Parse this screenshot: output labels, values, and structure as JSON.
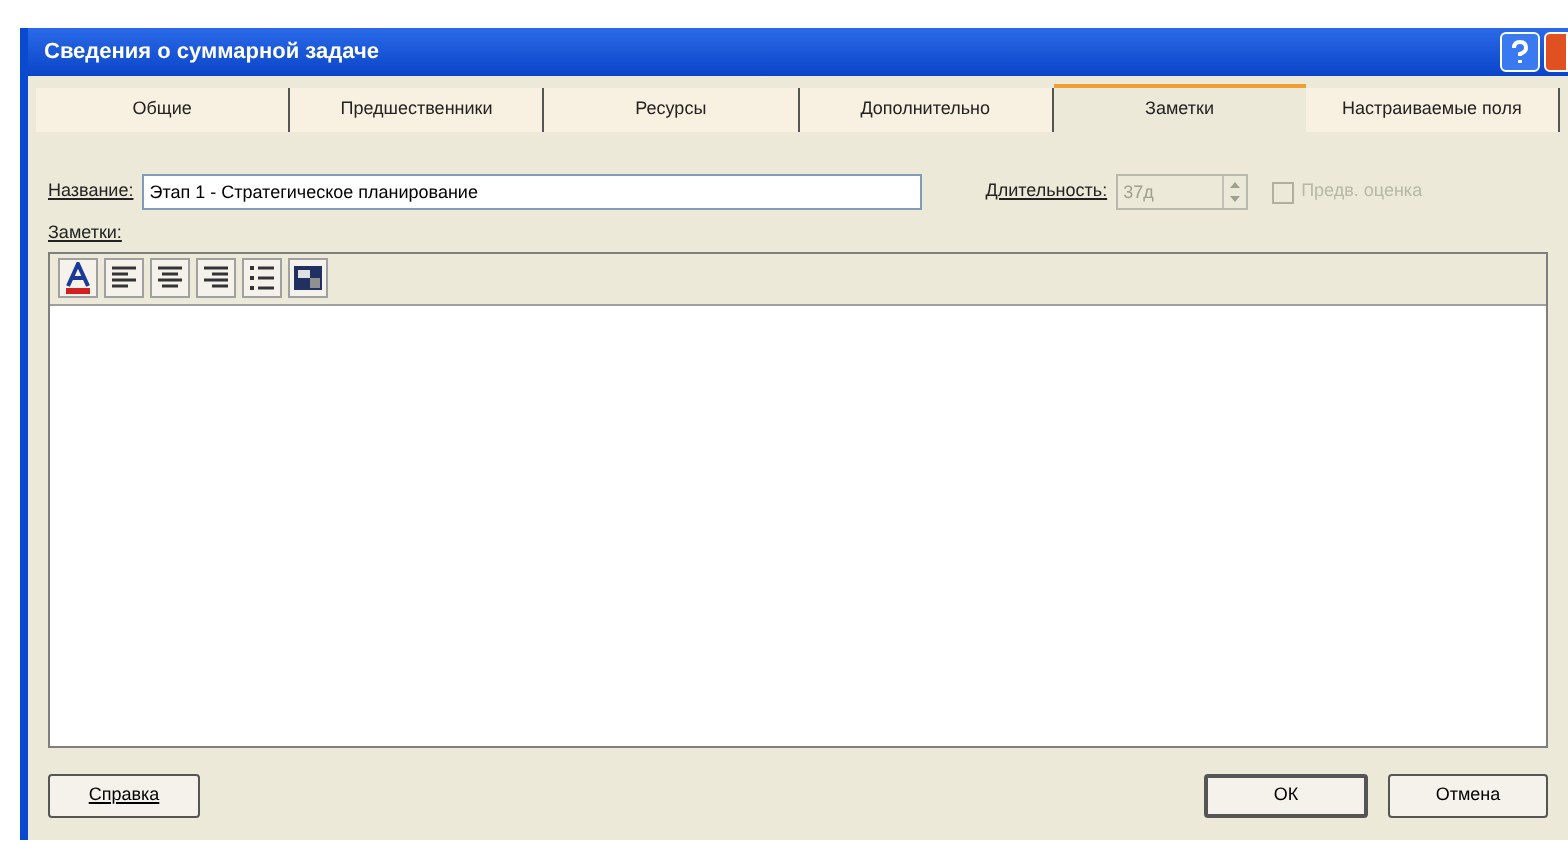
{
  "window": {
    "title": "Сведения о суммарной задаче"
  },
  "tabs": [
    {
      "label": "Общие",
      "selected": false
    },
    {
      "label": "Предшественники",
      "selected": false
    },
    {
      "label": "Ресурсы",
      "selected": false
    },
    {
      "label": "Дополнительно",
      "selected": false
    },
    {
      "label": "Заметки",
      "selected": true
    },
    {
      "label": "Настраиваемые поля",
      "selected": false
    }
  ],
  "name_field": {
    "label": "Название:",
    "value": "Этап 1 - Стратегическое планирование"
  },
  "duration_field": {
    "label": "Длительность:",
    "value": "37д",
    "disabled": true
  },
  "estimate_checkbox": {
    "label": "Предв. оценка",
    "checked": false,
    "disabled": true
  },
  "notes": {
    "label": "Заметки:",
    "toolbar": [
      {
        "kind": "font"
      },
      {
        "kind": "align-left"
      },
      {
        "kind": "align-center"
      },
      {
        "kind": "align-right"
      },
      {
        "kind": "bullets"
      },
      {
        "kind": "object"
      }
    ]
  },
  "buttons": {
    "help": "Справка",
    "ok": "ОК",
    "cancel": "Отмена"
  }
}
